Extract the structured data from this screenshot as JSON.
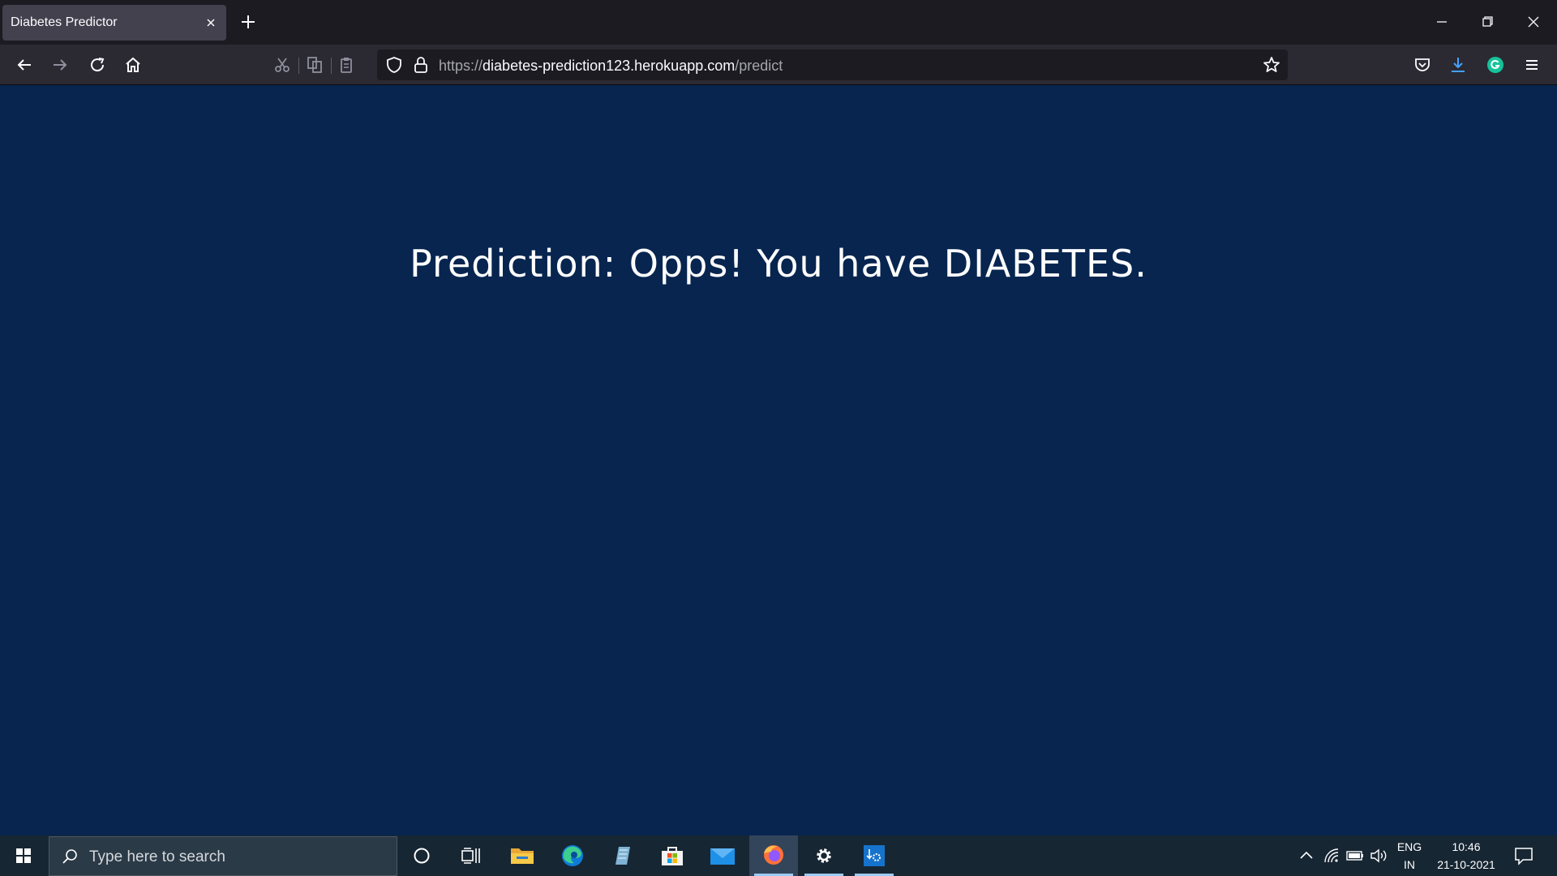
{
  "browser": {
    "tab": {
      "title": "Diabetes Predictor"
    },
    "url": {
      "prefix": "https://",
      "host": "diabetes-prediction123.herokuapp.com",
      "path": "/predict"
    }
  },
  "page": {
    "prediction_text": "Prediction: Opps! You have DIABETES."
  },
  "taskbar": {
    "search_placeholder": "Type here to search",
    "language_top": "ENG",
    "language_bottom": "IN",
    "time": "10:46",
    "date": "21-10-2021"
  },
  "colors": {
    "page_background": "#07254f",
    "browser_chrome": "#2b2a33",
    "tab_strip": "#1c1b22",
    "taskbar": "#172633"
  },
  "icons": [
    "close-icon",
    "plus-icon",
    "minimize-icon",
    "restore-icon",
    "back-arrow-icon",
    "forward-arrow-icon",
    "reload-icon",
    "home-icon",
    "cut-icon",
    "copy-icon",
    "paste-icon",
    "shield-icon",
    "lock-icon",
    "star-icon",
    "pocket-icon",
    "download-icon",
    "grammarly-icon",
    "hamburger-menu-icon",
    "windows-logo-icon",
    "search-icon",
    "cortana-icon",
    "task-view-icon",
    "file-explorer-icon",
    "edge-icon",
    "notepad-icon",
    "store-icon",
    "mail-icon",
    "firefox-icon",
    "settings-gear-icon",
    "app-icon",
    "chevron-up-icon",
    "wifi-icon",
    "battery-icon",
    "speaker-icon",
    "notification-icon"
  ]
}
